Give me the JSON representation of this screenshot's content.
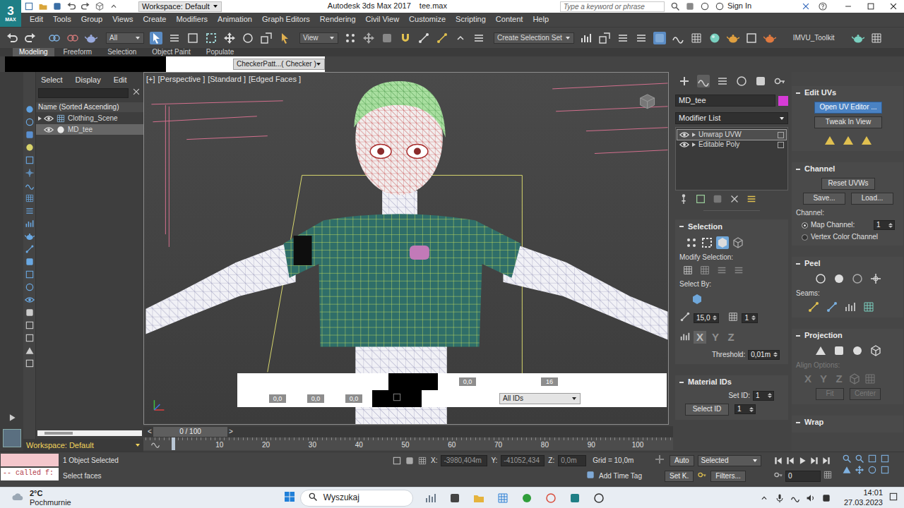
{
  "window": {
    "logo": "3",
    "logo_sub": "MAX",
    "workspace": "Workspace: Default",
    "title": "Autodesk 3ds Max 2017",
    "file": "tee.max",
    "search_placeholder": "Type a keyword or phrase",
    "sign_in": "Sign In"
  },
  "menu": [
    "Edit",
    "Tools",
    "Group",
    "Views",
    "Create",
    "Modifiers",
    "Animation",
    "Graph Editors",
    "Rendering",
    "Civil View",
    "Customize",
    "Scripting",
    "Content",
    "Help"
  ],
  "toolbar": {
    "filter": "All",
    "coordinate_system": "View",
    "selection_set": "Create Selection Set",
    "toolkit": "IMVU_Toolkit",
    "select_object_active": true,
    "ribbon_active": true
  },
  "ribbon_tabs": [
    {
      "label": "Modeling",
      "selected": true
    },
    {
      "label": "Freeform",
      "selected": false
    },
    {
      "label": "Selection",
      "selected": false
    },
    {
      "label": "Object Paint",
      "selected": false
    },
    {
      "label": "Populate",
      "selected": false
    }
  ],
  "viewport_material": "CheckerPatt...( Checker )",
  "scene_explorer": {
    "menu": [
      "Select",
      "Display",
      "Edit"
    ],
    "column": "Name (Sorted Ascending)",
    "items": [
      {
        "name": "Clothing_Scene",
        "kind": "group",
        "selected": false
      },
      {
        "name": "MD_tee",
        "kind": "object",
        "selected": true
      }
    ],
    "workspace": "Workspace: Default"
  },
  "viewport": {
    "labels": [
      "[+]",
      "[Perspective ]",
      "[Standard ]",
      "[Edged Faces ]"
    ]
  },
  "uv_toolbar": {
    "u": "0,0",
    "count": "16",
    "fields": [
      "0,0",
      "0,0",
      "0,0"
    ],
    "id_filter": "All IDs"
  },
  "command_panel": {
    "tabs": [
      {
        "kind": "create",
        "selected": false
      },
      {
        "kind": "modify",
        "selected": true
      },
      {
        "kind": "hierarchy",
        "selected": false
      },
      {
        "kind": "motion",
        "selected": false
      },
      {
        "kind": "display",
        "selected": false
      },
      {
        "kind": "utilities",
        "selected": false
      }
    ],
    "object_name": "MD_tee",
    "modifier_list": "Modifier List",
    "stack": [
      {
        "label": "Unwrap UVW",
        "selected": true
      },
      {
        "label": "Editable Poly",
        "selected": false
      }
    ],
    "selection": {
      "title": "Selection",
      "modes": [
        {
          "kind": "vertex",
          "selected": false
        },
        {
          "kind": "edge",
          "selected": false
        },
        {
          "kind": "face",
          "selected": true
        }
      ],
      "modify_selection": "Modify Selection:",
      "select_by": "Select By:",
      "angle": "15,0",
      "count": "1",
      "axes": [
        {
          "label": "X",
          "selected": true
        },
        {
          "label": "Y",
          "selected": false
        },
        {
          "label": "Z",
          "selected": false
        }
      ],
      "threshold_label": "Threshold:",
      "threshold": "0,01m"
    },
    "material_ids": {
      "title": "Material IDs",
      "set_id_label": "Set ID:",
      "set_id": "1",
      "select_button": "Select ID",
      "select_id": "1"
    }
  },
  "edit_panel": {
    "edit_uvs": {
      "title": "Edit UVs",
      "open": "Open UV Editor ...",
      "tweak": "Tweak In View"
    },
    "channel": {
      "title": "Channel",
      "reset": "Reset UVWs",
      "save": "Save...",
      "load": "Load...",
      "label": "Channel:",
      "options": [
        {
          "label": "Map Channel:",
          "selected": true
        },
        {
          "label": "Vertex Color Channel",
          "selected": false
        }
      ],
      "map_channel": "1"
    },
    "peel": {
      "title": "Peel",
      "seams": "Seams:"
    },
    "projection": {
      "title": "Projection",
      "align_label": "Align Options:",
      "axes": [
        "X",
        "Y",
        "Z"
      ],
      "fit": "Fit",
      "center": "Center",
      "disabled": true
    },
    "wrap": {
      "title": "Wrap"
    }
  },
  "timeline": {
    "prev": "<",
    "counter": "0 / 100",
    "next": ">",
    "ticks": [
      "10",
      "20",
      "30",
      "40",
      "50",
      "60",
      "70",
      "80",
      "90",
      "100"
    ]
  },
  "status": {
    "listener": "-- called f:",
    "selection": "1 Object Selected",
    "prompt": "Select faces",
    "x_label": "X:",
    "x": "-3980,404m",
    "y_label": "Y:",
    "y": "-41052,434",
    "z_label": "Z:",
    "z": "0,0m",
    "grid": "Grid = 10,0m",
    "time_tag": "Add Time Tag",
    "auto": "Auto",
    "key_mode": "Selected",
    "set_key": "Set K.",
    "filters": "Filters...",
    "frame": "0"
  },
  "taskbar": {
    "temperature": "2°C",
    "weather": "Pochmurnie",
    "search": "Wyszukaj",
    "time": "14:01",
    "date": "27.03.2023"
  }
}
